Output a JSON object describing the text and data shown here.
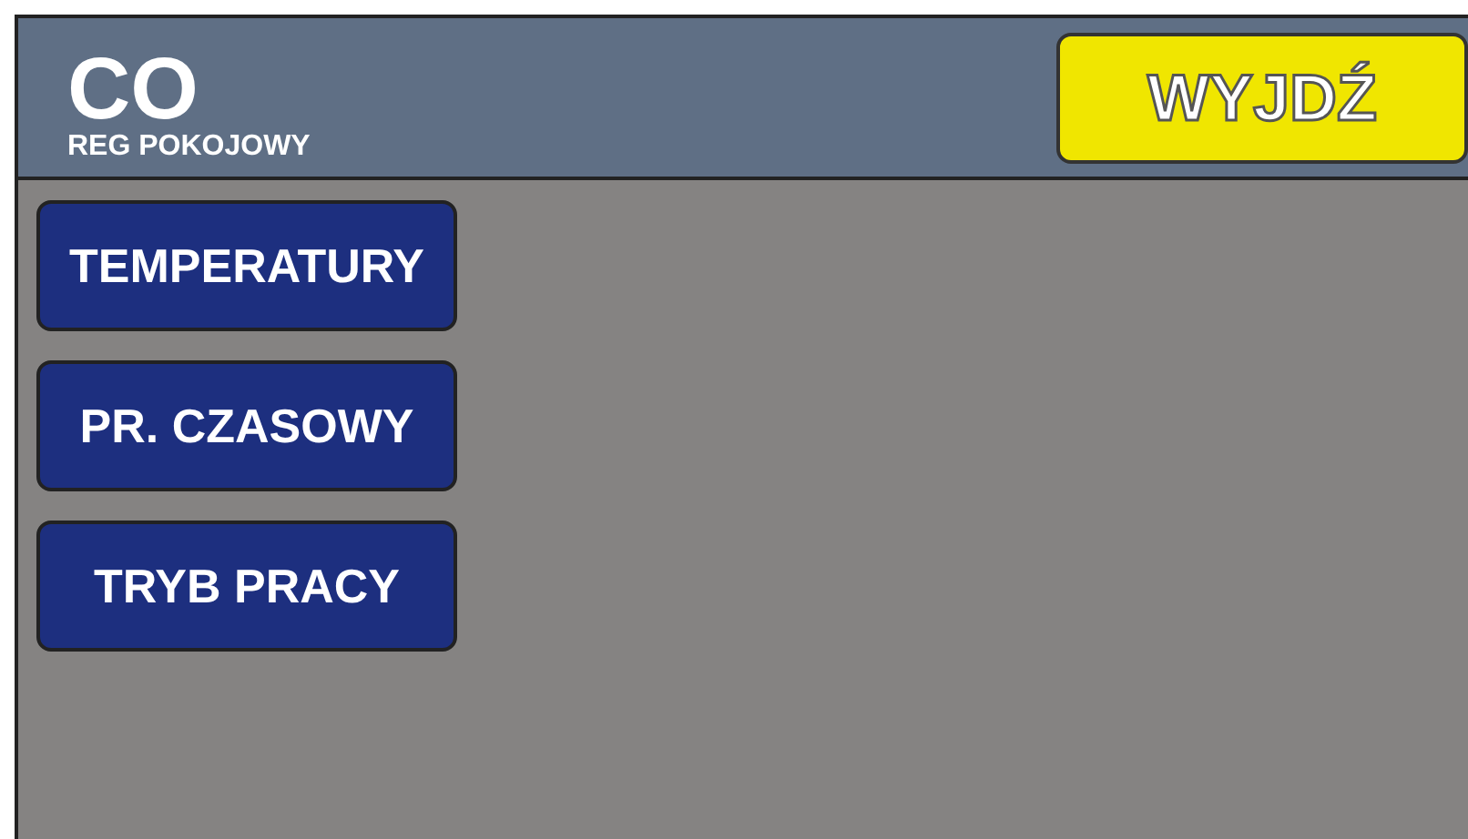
{
  "header": {
    "title": "CO",
    "subtitle": "REG POKOJOWY",
    "exit_button": "WYJDŹ"
  },
  "menu_buttons": [
    "TEMPERATURY",
    "PR. CZASOWY",
    "TRYB PRACY"
  ]
}
